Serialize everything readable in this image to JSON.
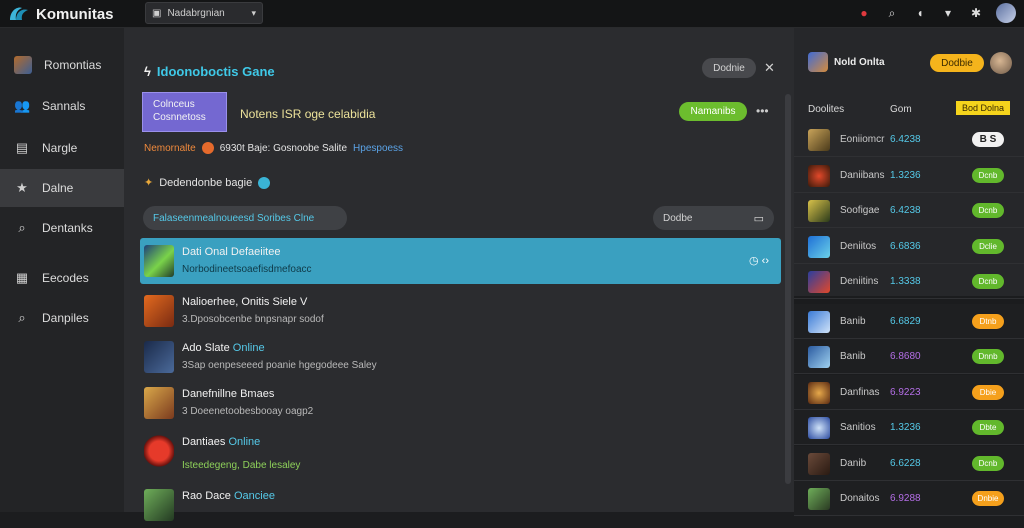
{
  "app": {
    "title": "Komunitas"
  },
  "topbar": {
    "select_label": "Nadabrgnian"
  },
  "sidebar": {
    "items": [
      {
        "label": "Romontias",
        "icon": "avatar-icon"
      },
      {
        "label": "Sannals",
        "icon": "users-icon"
      },
      {
        "label": "Nargle",
        "icon": "book-icon"
      },
      {
        "label": "Dalne",
        "icon": "star-icon",
        "active": true
      },
      {
        "label": "Dentanks",
        "icon": "search-icon"
      },
      {
        "label": "Eecodes",
        "icon": "grid-icon"
      },
      {
        "label": "Danpiles",
        "icon": "search-icon"
      }
    ]
  },
  "main": {
    "header_title": "Idoonoboctis Gane",
    "close_pill": "Dodnie",
    "purple_box_line1": "Colnceus",
    "purple_box_line2": "Cosnnetoss",
    "notes_text": "Notens ISR oge celabidia",
    "green_btn": "Namanibs",
    "meta_orange": "Nemornalte",
    "meta_white": "6930t Baje: Gosnoobe Salite",
    "meta_blue": "Hpespoess",
    "sub_head": "Dedendonbe bagie",
    "search_label": "Falaseenmealnoueesd Soribes Clne",
    "filter_label": "Dodbe",
    "rows": [
      {
        "title": "Dati Onal Defaeiitee",
        "online": "",
        "sub": "Norbodineetsoaefisdmefoacc",
        "selected": true
      },
      {
        "title": "Nalioerhee, Onitis Siele V",
        "online": "",
        "sub": "3.Dposobcenbe bnpsnapr sodof"
      },
      {
        "title": "Ado Slate",
        "online": "Online",
        "sub": "3Sap oenpeseeed poanie hgegodeee Saley"
      },
      {
        "title": "Danefnillne Bmaes",
        "online": "",
        "sub": "3 Doeenetoobesbooay oagp2"
      },
      {
        "title": "Dantiaes",
        "online": "Online",
        "sub": "Isteedegeng, Dabe lesaley",
        "green": true
      },
      {
        "title": "Rao Dace",
        "online": "Oanciee",
        "sub": ""
      }
    ]
  },
  "right": {
    "title": "Nold Onlta",
    "yellow_btn": "Dodbie",
    "col1": "Doolites",
    "col2": "Gom",
    "col3": "Bod Dolna",
    "rows": [
      {
        "name": "Eoniiomcr",
        "score": "6.4238",
        "btn": "B S",
        "btn_style": "white",
        "score_color": "#55c9e8"
      },
      {
        "name": "Daniibans",
        "score": "1.3236",
        "btn": "Dcnb",
        "btn_style": "green",
        "score_color": "#55c9e8"
      },
      {
        "name": "Soofigae",
        "score": "6.4238",
        "btn": "Dcnb",
        "btn_style": "green",
        "score_color": "#55c9e8"
      },
      {
        "name": "Deniitos",
        "score": "6.6836",
        "btn": "Dclie",
        "btn_style": "green",
        "score_color": "#55c9e8"
      },
      {
        "name": "Deniitins",
        "score": "1.3338",
        "btn": "Dcnb",
        "btn_style": "green",
        "score_color": "#55c9e8"
      },
      {
        "name": "Banib",
        "score": "6.6829",
        "btn": "Dtnb",
        "btn_style": "orange",
        "score_color": "#55c9e8"
      },
      {
        "name": "Banib",
        "score": "6.8680",
        "btn": "Dnnb",
        "btn_style": "green",
        "score_color": "#b46ee6"
      },
      {
        "name": "Danfinas",
        "score": "6.9223",
        "btn": "Dbie",
        "btn_style": "orange",
        "score_color": "#b46ee6"
      },
      {
        "name": "Sanitios",
        "score": "1.3236",
        "btn": "Dbte",
        "btn_style": "green",
        "score_color": "#55c9e8"
      },
      {
        "name": "Danib",
        "score": "6.6228",
        "btn": "Dcnb",
        "btn_style": "green",
        "score_color": "#55c9e8"
      },
      {
        "name": "Donaitos",
        "score": "6.9288",
        "btn": "Dnbie",
        "btn_style": "orange",
        "score_color": "#b46ee6"
      }
    ]
  }
}
